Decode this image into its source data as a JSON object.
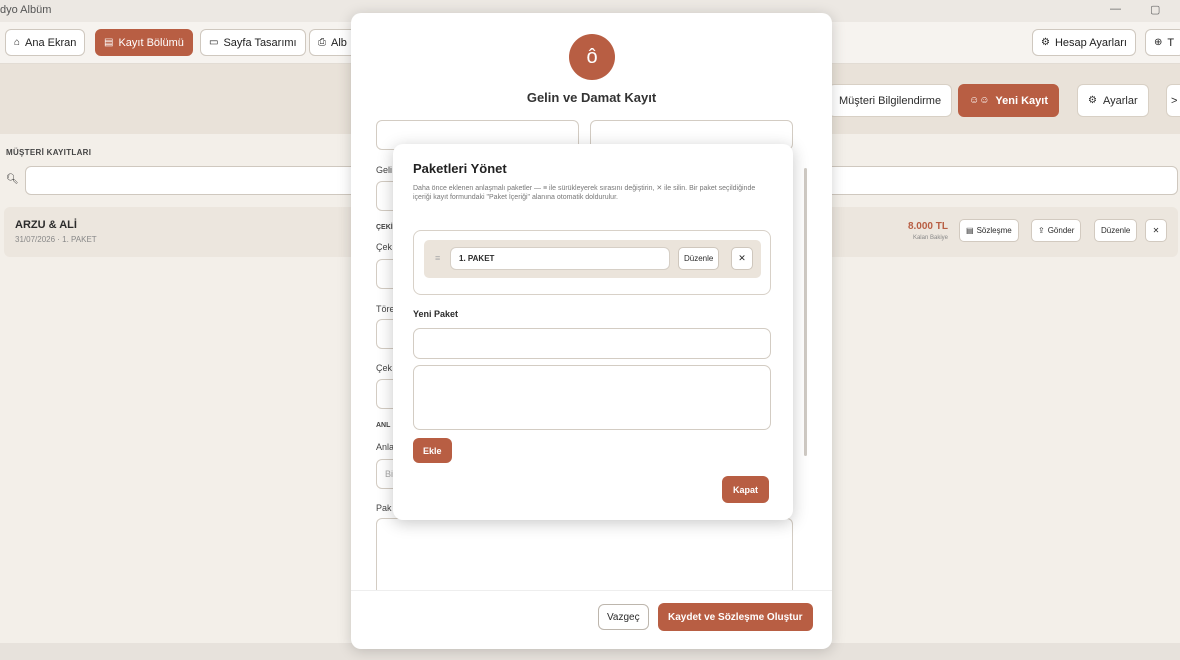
{
  "app": {
    "title": "dyo Albüm"
  },
  "nav": {
    "home": "Ana Ekran",
    "register": "Kayıt Bölümü",
    "page_design": "Sayfa Tasarımı",
    "album": "Alb",
    "account": "Hesap Ayarları",
    "more": "T"
  },
  "toolbar": {
    "customer_info": "Müşteri Bilgilendirme",
    "new_record": "Yeni Kayıt",
    "settings": "Ayarlar",
    "overflow": ">"
  },
  "records": {
    "section_title": "MÜŞTERİ KAYITLARI",
    "items": [
      {
        "name": "ARZU & ALİ",
        "subtitle": "31/07/2026 · 1. PAKET",
        "amount": "8.000 TL",
        "amount_label": "Kalan Bakiye",
        "contract": "Sözleşme",
        "send": "Gönder",
        "edit": "Düzenle"
      }
    ]
  },
  "registration_modal": {
    "title": "Gelin ve Damat Kayıt",
    "labels": {
      "gel": "Geli",
      "cek_section": "ÇEKİ",
      "cek": "Çek",
      "toren": "Töre",
      "cek2": "Çek",
      "anl_section": "ANL",
      "anl": "Anla",
      "anl_placeholder": "Bi",
      "paket": "Pak"
    },
    "cancel": "Vazgeç",
    "save": "Kaydet ve Sözleşme Oluştur"
  },
  "package_modal": {
    "title": "Paketleri Yönet",
    "description": "Daha önce eklenen anlaşmalı paketler — ≡ ile sürükleyerek sırasını değiştirin, ✕ ile silin. Bir paket seçildiğinde içeriği kayıt formundaki \"Paket İçeriği\" alanına otomatik doldurulur.",
    "packages": [
      {
        "name": "1. PAKET",
        "edit": "Düzenle"
      }
    ],
    "new_label": "Yeni Paket",
    "add": "Ekle",
    "close": "Kapat"
  },
  "colors": {
    "accent": "#b85e43",
    "background": "#f3efe9"
  }
}
